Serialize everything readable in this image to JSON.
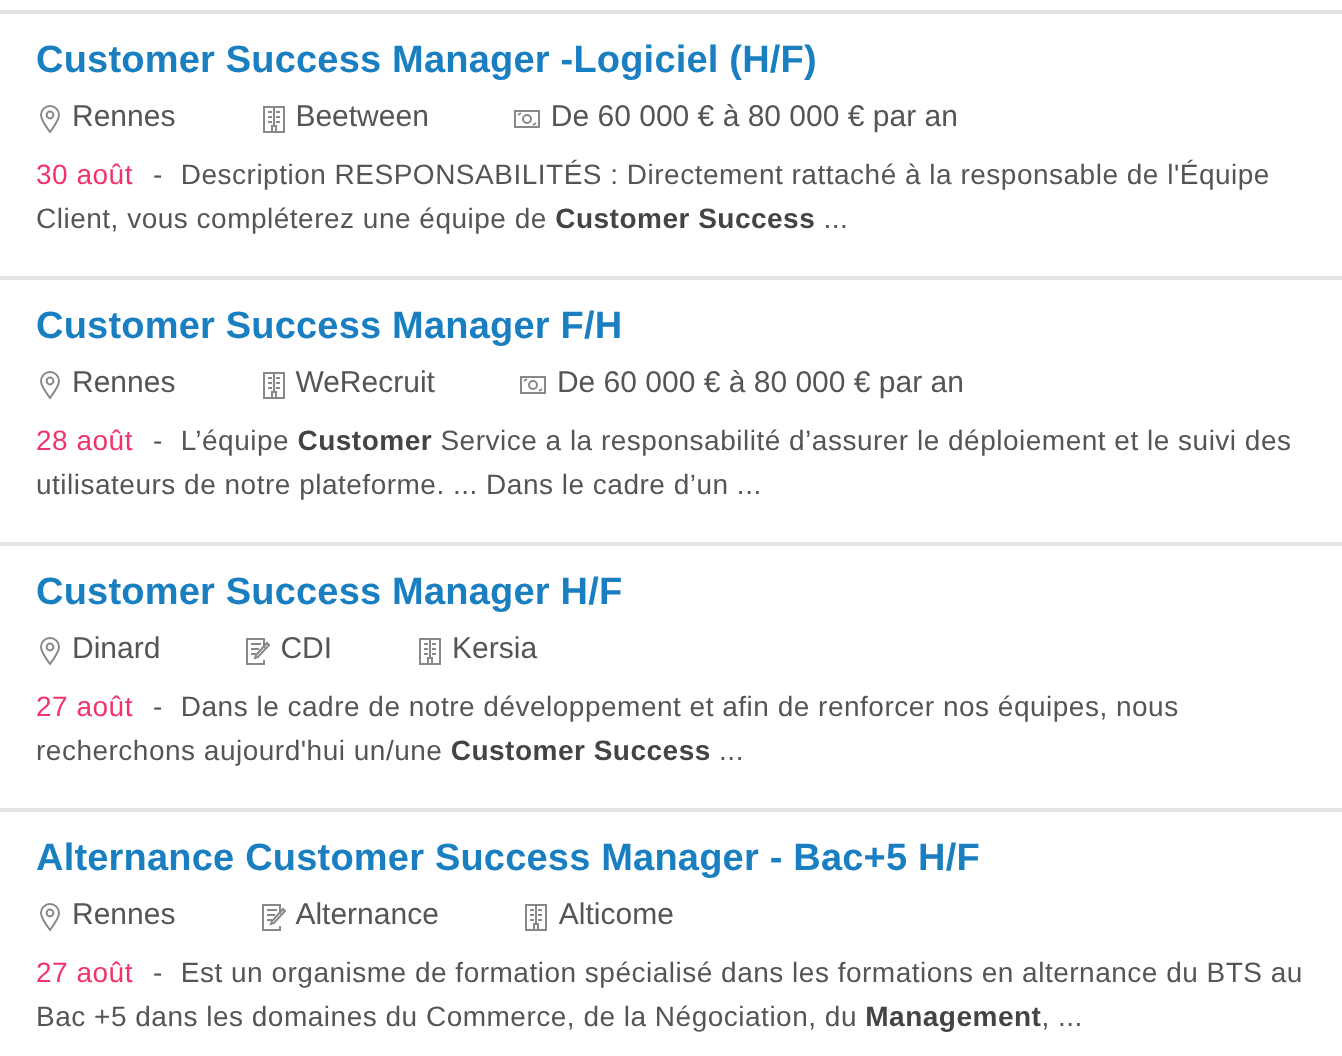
{
  "jobs": [
    {
      "title": "Customer Success Manager -Logiciel (H/F)",
      "meta": [
        {
          "kind": "location",
          "text": "Rennes"
        },
        {
          "kind": "company",
          "text": "Beetween"
        },
        {
          "kind": "salary",
          "text": "De 60 000 € à 80 000 € par an"
        }
      ],
      "date": "30 août",
      "separator": "-",
      "description": "Description RESPONSABILITÉS : Directement rattaché à la responsable de l'Équipe Client, vous compléterez une équipe de **Customer Success** ..."
    },
    {
      "title": "Customer Success Manager F/H",
      "meta": [
        {
          "kind": "location",
          "text": "Rennes"
        },
        {
          "kind": "company",
          "text": "WeRecruit"
        },
        {
          "kind": "salary",
          "text": "De 60 000 € à 80 000 € par an"
        }
      ],
      "date": "28 août",
      "separator": "-",
      "description": "L’équipe **Customer** Service a la responsabilité d’assurer le déploiement et le suivi des utilisateurs de notre plateforme. ... Dans le cadre d’un ..."
    },
    {
      "title": "Customer Success Manager H/F",
      "meta": [
        {
          "kind": "location",
          "text": "Dinard"
        },
        {
          "kind": "contract",
          "text": "CDI"
        },
        {
          "kind": "company",
          "text": "Kersia"
        }
      ],
      "date": "27 août",
      "separator": "-",
      "description": "Dans le cadre de notre développement et afin de renforcer nos équipes, nous recherchons aujourd'hui un/une **Customer Success** ..."
    },
    {
      "title": "Alternance Customer Success Manager - Bac+5 H/F",
      "meta": [
        {
          "kind": "location",
          "text": "Rennes"
        },
        {
          "kind": "contract",
          "text": "Alternance"
        },
        {
          "kind": "company",
          "text": "Alticome"
        }
      ],
      "date": "27 août",
      "separator": "-",
      "description": "Est un organisme de formation spécialisé dans les formations en alternance du BTS au Bac +5 dans les domaines du Commerce, de la Négociation, du **Management**, ..."
    }
  ]
}
